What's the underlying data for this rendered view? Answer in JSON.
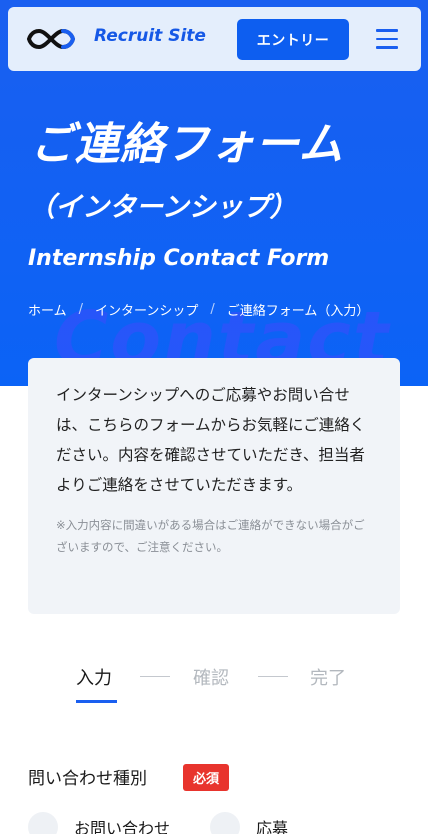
{
  "header": {
    "site_name": "Recruit Site",
    "entry_label": "エントリー",
    "logo_icon": "infinity-logo-icon",
    "menu_icon": "hamburger-menu-icon"
  },
  "hero": {
    "title": "ご連絡フォーム",
    "subtitle": "（インターンシップ）",
    "title_en": "Internship Contact Form",
    "watermark": "Contact",
    "breadcrumb": [
      "ホーム",
      "インターンシップ",
      "ご連絡フォーム（入力）"
    ],
    "breadcrumb_separator": "/"
  },
  "intro": {
    "text": "インターンシップへのご応募やお問い合せは、こちらのフォームからお気軽にご連絡ください。内容を確認させていただき、担当者よりご連絡をさせていただきます。",
    "note": "※入力内容に間違いがある場合はご連絡ができない場合がございますので、ご注意ください。"
  },
  "steps": {
    "items": [
      "入力",
      "確認",
      "完了"
    ],
    "active_index": 0
  },
  "form": {
    "inquiry_type_label": "問い合わせ種別",
    "required_label": "必須",
    "options": [
      "お問い合わせ",
      "応募"
    ]
  },
  "colors": {
    "accent": "#0d5ef0",
    "required": "#e8342d"
  }
}
